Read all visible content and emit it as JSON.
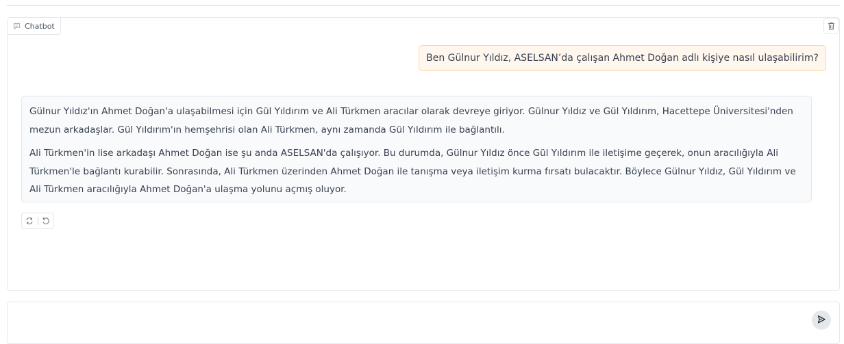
{
  "chatbot": {
    "label": "Chatbot",
    "label_icon": "chat-bubble-icon",
    "clear_icon": "trash-icon"
  },
  "messages": {
    "user": {
      "text": "Ben Gülnur Yıldız, ASELSAN’da çalışan Ahmet Doğan adlı kişiye nasıl ulaşabilirim?"
    },
    "bot": {
      "paragraphs": [
        "Gülnur Yıldız'ın Ahmet Doğan'a ulaşabilmesi için Gül Yıldırım ve Ali Türkmen aracılar olarak devreye giriyor. Gülnur Yıldız ve Gül Yıldırım, Hacettepe Üniversitesi'nden mezun arkadaşlar. Gül Yıldırım'ın hemşehrisi olan Ali Türkmen, aynı zamanda Gül Yıldırım ile bağlantılı.",
        "Ali Türkmen'in lise arkadaşı Ahmet Doğan ise şu anda ASELSAN'da çalışıyor. Bu durumda, Gülnur Yıldız önce Gül Yıldırım ile iletişime geçerek, onun aracılığıyla Ali Türkmen'le bağlantı kurabilir. Sonrasında, Ali Türkmen üzerinden Ahmet Doğan ile tanışma veya iletişim kurma fırsatı bulacaktır. Böylece Gülnur Yıldız, Gül Yıldırım ve Ali Türkmen aracılığıyla Ahmet Doğan'a ulaşma yolunu açmış oluyor."
      ],
      "actions": [
        "retry-icon",
        "undo-icon"
      ]
    }
  },
  "input": {
    "value": "",
    "placeholder": "",
    "send_icon": "send-icon"
  },
  "colors": {
    "user_bubble_bg": "#fff7ed",
    "user_bubble_border": "#fed7aa",
    "bot_bubble_bg": "#f9fafb",
    "border": "#e5e7eb"
  }
}
